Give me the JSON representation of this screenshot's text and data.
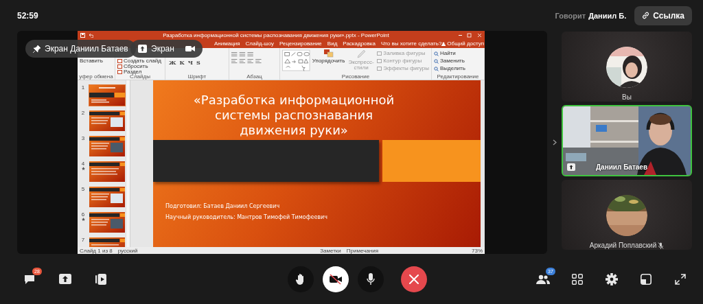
{
  "top_bar": {
    "timer": "52:59",
    "speaker_label": "Говорит",
    "speaker_name": "Даниил Б.",
    "link_button": "Ссылка"
  },
  "screen_share": {
    "pills": [
      {
        "kind": "owner",
        "label": "Экран Даниил Батаев"
      },
      {
        "kind": "share",
        "label": "Экран"
      }
    ],
    "powerpoint": {
      "title": "Разработка информационной системы распознавания движения руки».pptx - PowerPoint",
      "tabs": [
        {
          "label": "Анимация",
          "selected": false
        },
        {
          "label": "Слайд-шоу",
          "selected": false
        },
        {
          "label": "Рецензирование",
          "selected": false
        },
        {
          "label": "Вид",
          "selected": false
        },
        {
          "label": "Раскадровка",
          "selected": false
        }
      ],
      "tell_me": "Что вы хотите сделать?",
      "share": "Общий доступ",
      "groups": [
        {
          "kind": "clipboard",
          "label": "уфер обмена",
          "buttons": [
            "Вставить"
          ]
        },
        {
          "kind": "slides",
          "label": "Слайды",
          "buttons": [
            "Создать слайд",
            "Сбросить",
            "Раздел"
          ]
        },
        {
          "kind": "font",
          "label": "Шрифт",
          "buttons": [
            "Ж",
            "К",
            "Ч",
            "S"
          ]
        },
        {
          "kind": "paragraph",
          "label": "Абзац"
        },
        {
          "kind": "drawing",
          "label": "Рисование",
          "buttons": [
            "Упорядочить",
            "Экспресс-стили",
            "Заливка фигуры",
            "Контур фигуры",
            "Эффекты фигуры"
          ]
        },
        {
          "kind": "editing",
          "label": "Редактирование",
          "buttons": [
            "Найти",
            "Заменить",
            "Выделить"
          ]
        }
      ],
      "thumbnails": [
        {
          "number": "1",
          "selected": true,
          "animated": false
        },
        {
          "number": "2",
          "selected": false,
          "animated": false
        },
        {
          "number": "3",
          "selected": false,
          "animated": false
        },
        {
          "number": "4",
          "selected": false,
          "animated": true
        },
        {
          "number": "5",
          "selected": false,
          "animated": false
        },
        {
          "number": "6",
          "selected": false,
          "animated": true
        },
        {
          "number": "7",
          "selected": false,
          "animated": false
        }
      ],
      "slide": {
        "title_lines": [
          "«Разработка информационной",
          "системы распознавания",
          "движения руки»"
        ],
        "lines": [
          "Подготовил: Батаев Даниил Сергеевич",
          "Научный руководитель: Мантров Тимофей Тимофеевич"
        ]
      },
      "status": {
        "slide_counter": "Слайд 1 из 8",
        "language": "русский",
        "notes": "Заметки",
        "comments": "Примечания",
        "zoom": "73%"
      }
    }
  },
  "participants": [
    {
      "name": "Вы",
      "kind": "avatar",
      "speaking": false,
      "muted": false,
      "sharing": false
    },
    {
      "name": "Даниил Батаев",
      "kind": "video",
      "speaking": true,
      "muted": false,
      "sharing": true
    },
    {
      "name": "Аркадий Поплавский",
      "kind": "avatar",
      "speaking": false,
      "muted": true,
      "sharing": false
    }
  ],
  "toolbar": {
    "chat_badge": "28",
    "people_badge": "37",
    "camera_on": false
  }
}
